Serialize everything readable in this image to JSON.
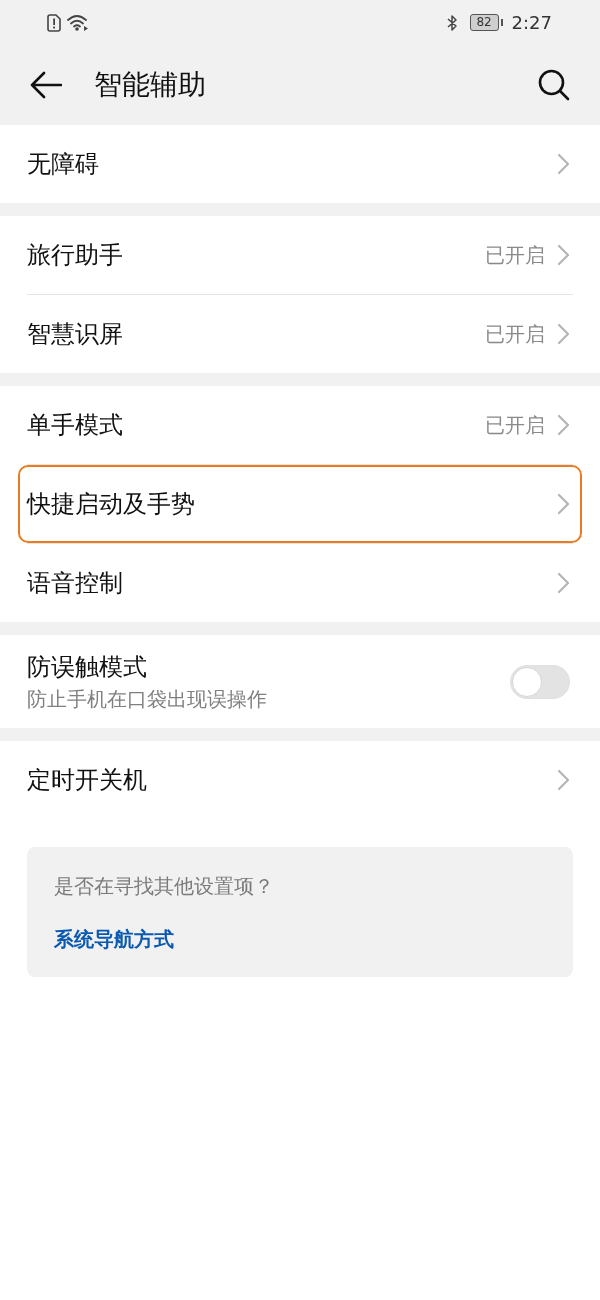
{
  "status_bar": {
    "battery": "82",
    "time": "2:27"
  },
  "header": {
    "title": "智能辅助"
  },
  "groups": [
    {
      "items": [
        {
          "kind": "link",
          "label": "无障碍",
          "highlighted": false
        }
      ]
    },
    {
      "items": [
        {
          "kind": "link",
          "label": "旅行助手",
          "value": "已开启",
          "highlighted": false
        },
        {
          "kind": "link",
          "label": "智慧识屏",
          "value": "已开启",
          "highlighted": false
        }
      ]
    },
    {
      "items": [
        {
          "kind": "link",
          "label": "单手模式",
          "value": "已开启",
          "highlighted": false
        },
        {
          "kind": "link",
          "label": "快捷启动及手势",
          "highlighted": true
        },
        {
          "kind": "link",
          "label": "语音控制",
          "highlighted": false
        }
      ]
    },
    {
      "items": [
        {
          "kind": "toggle",
          "label": "防误触模式",
          "description": "防止手机在口袋出现误操作",
          "on": false,
          "highlighted": false
        }
      ]
    },
    {
      "items": [
        {
          "kind": "link",
          "label": "定时开关机",
          "highlighted": false
        }
      ]
    }
  ],
  "suggestion_card": {
    "question": "是否在寻找其他设置项？",
    "link": "系统导航方式"
  }
}
